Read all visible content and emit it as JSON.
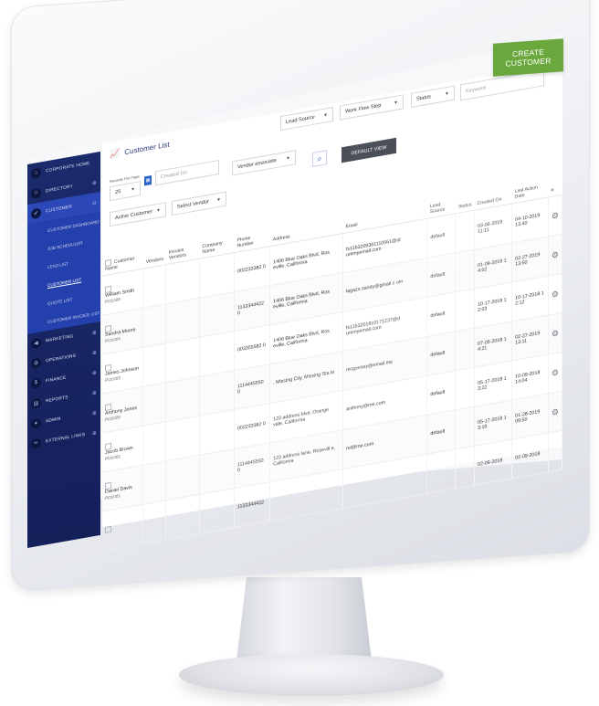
{
  "toolbar": {
    "create_label": "CREATE CUSTOMER"
  },
  "page": {
    "title": "Customer List"
  },
  "filters": {
    "records_label": "Records Per Page",
    "records_value": "25",
    "created_on_placeholder": "Created On",
    "lead_source": "Lead Source",
    "workflow_step": "Work Flow Step",
    "status": "Status",
    "keyword_placeholder": "Keyword",
    "active_customer": "Active Customer",
    "select_vendor": "Select Vendor",
    "vendor_associate": "Vendor associate",
    "default_view": "DEFAULT VIEW"
  },
  "sidebar": {
    "items": [
      {
        "label": "CORPORATE HOME",
        "icon": "home-icon"
      },
      {
        "label": "DIRECTORY",
        "icon": "directory-icon"
      },
      {
        "label": "CUSTOMER",
        "icon": "customer-icon"
      },
      {
        "label": "MARKETING",
        "icon": "megaphone-icon"
      },
      {
        "label": "OPERATIONS",
        "icon": "operations-icon"
      },
      {
        "label": "FINANCE",
        "icon": "dollar-icon"
      },
      {
        "label": "REPORTS",
        "icon": "reports-icon"
      },
      {
        "label": "ADMIN",
        "icon": "admin-icon"
      },
      {
        "label": "EXTERNAL LINKS",
        "icon": "link-icon"
      }
    ],
    "customer_sub": [
      "CUSTOMER DASHBOARD",
      "JOB SCHEDULER",
      "LEAD LIST",
      "CUSTOMER LIST",
      "QUOTE LIST",
      "CUSTOMER INVOICE LIST"
    ]
  },
  "table": {
    "headers": [
      "Customer Name",
      "Vendors",
      "Invoice Vendors",
      "Company Name",
      "Phone Number",
      "Address",
      "Email",
      "Lead Source",
      "Status",
      "Created On",
      "Last Action Date",
      "#"
    ],
    "rows": [
      {
        "name": "William Smith",
        "id": "PO1006",
        "phone": "002233382 0",
        "address": "1406 Blue Oaks Blvd, Ros eville, California",
        "email": "fs1163209361110561@id ummyemail.com",
        "lead": "default",
        "created": "03-06-2019 11:11",
        "last": "04-10-2019 13:40"
      },
      {
        "name": "Sandra Moore",
        "id": "PO1004",
        "phone": "1133344422 0",
        "address": "1406 Blue Oaks Blvd, Ros eville, California",
        "email": "lagazo.sandy@gmail.c om",
        "lead": "default",
        "created": "01-09-2019 1 4:02",
        "last": "02-27-2019 13:50"
      },
      {
        "name": "James Johnson",
        "id": "PO1003",
        "phone": "003355582 0",
        "address": "1406 Blue Oaks Blvd, Ros eville, California",
        "email": "fs1163201810171237@d ummyemail.com",
        "lead": "default",
        "created": "10-17-2018 1 2:03",
        "last": "10-17-2018 1 2:12"
      },
      {
        "name": "Anthony Jones",
        "id": "PO1005",
        "phone": "1114445550 0",
        "address": ", Missing City, Missing Sta te",
        "email": "mcgeesey@email.me",
        "lead": "default",
        "created": "07-05-2018 1 4:21",
        "last": "02-27-2019 13:11"
      },
      {
        "name": "Jacob Brown",
        "id": "PO1002",
        "phone": "002233382 0",
        "address": "123 address blvd, Orange vale, California",
        "email": "anthony@me.com",
        "lead": "default",
        "created": "05-17-2018 1 3:22",
        "last": "10-09-2018 14:04"
      },
      {
        "name": "Daniel Davis",
        "id": "PO1001",
        "phone": "1114445550 0",
        "address": "123 address lane, Rosevill e, California",
        "email": "rel@me.com",
        "lead": "default",
        "created": "05-17-2018 1 3:19",
        "last": "01-28-2019 09:50"
      },
      {
        "name": "",
        "id": "",
        "phone": "1133344422",
        "address": "",
        "email": "",
        "lead": "",
        "created": "02-09-2018",
        "last": "02-09-2018"
      }
    ]
  }
}
